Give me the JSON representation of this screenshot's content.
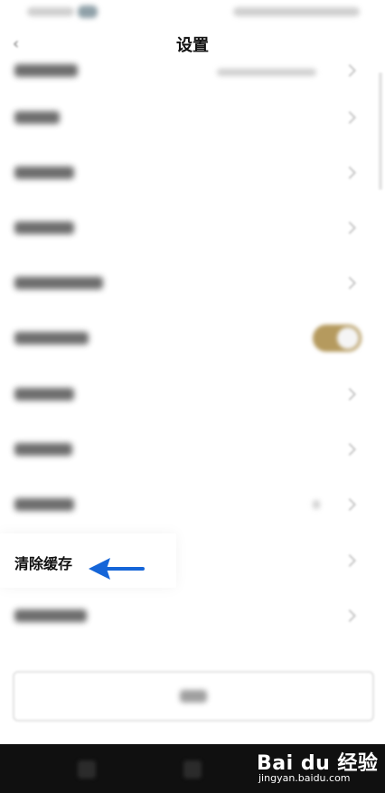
{
  "header": {
    "title": "设置",
    "back_icon": "back-arrow-icon"
  },
  "settings": {
    "highlighted_item_label": "清除缓存",
    "toggle_state": "on"
  },
  "colors": {
    "accent_toggle": "#b59a5e",
    "arrow_annotation": "#1565d8",
    "nav_bar": "#101010"
  },
  "watermark": {
    "brand": "Bai du 经验",
    "url": "jingyan.baidu.com"
  }
}
